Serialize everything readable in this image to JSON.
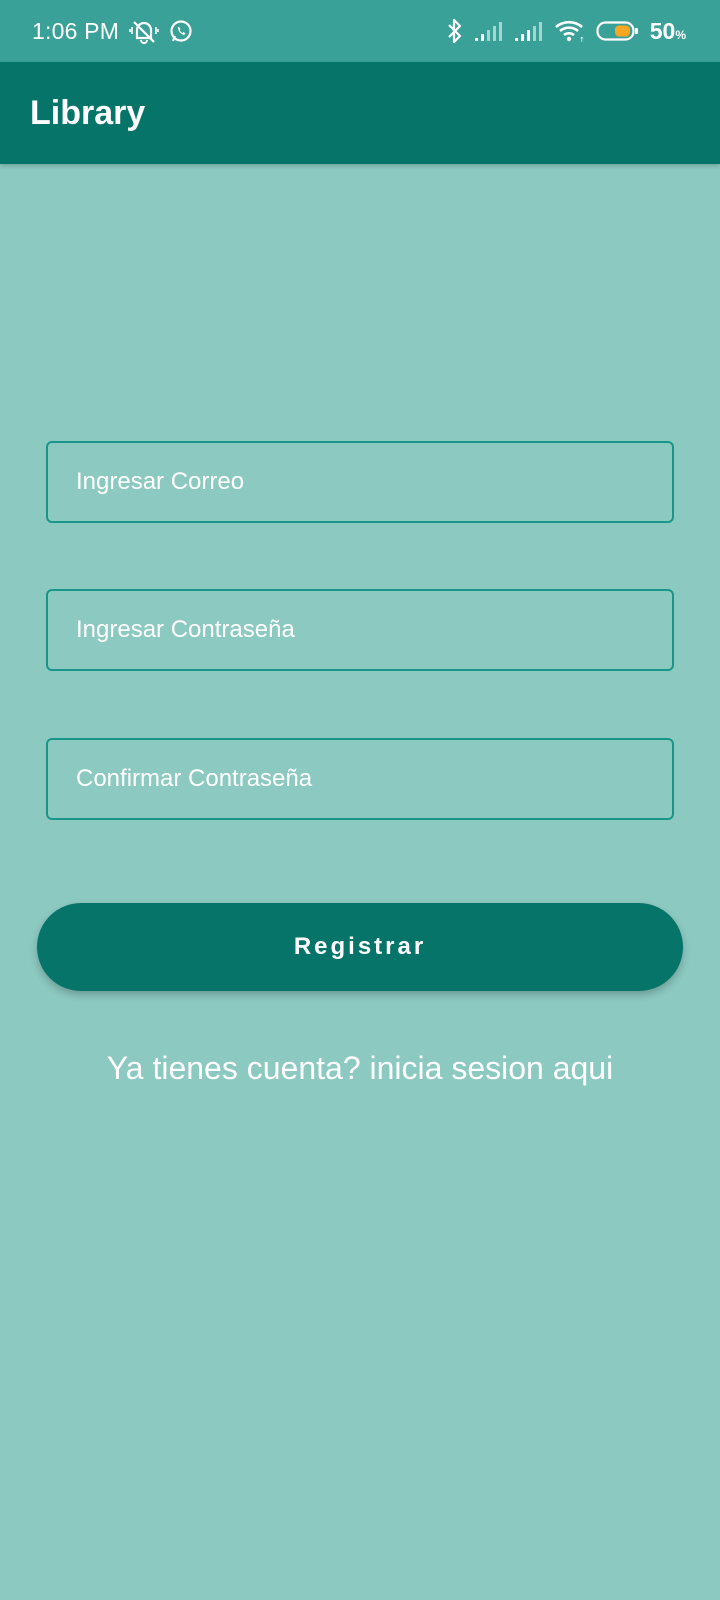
{
  "status_bar": {
    "time": "1:06 PM",
    "battery_percent": "50",
    "battery_unit": "%",
    "icons": [
      "vibrate-mute-icon",
      "whatsapp-icon",
      "bluetooth-icon",
      "signal-icon",
      "signal-icon",
      "wifi-icon",
      "battery-icon"
    ]
  },
  "app_bar": {
    "title": "Library"
  },
  "form": {
    "email_placeholder": "Ingresar Correo",
    "password_placeholder": "Ingresar Contraseña",
    "confirm_placeholder": "Confirmar Contraseña",
    "register_label": "Registrar",
    "login_link": "Ya tienes cuenta? inicia sesion aqui"
  },
  "colors": {
    "background": "#8cc9c1",
    "status_bar": "#3aa198",
    "primary": "#07746a",
    "field_border": "#1a958a",
    "battery_fill": "#f5a623"
  }
}
